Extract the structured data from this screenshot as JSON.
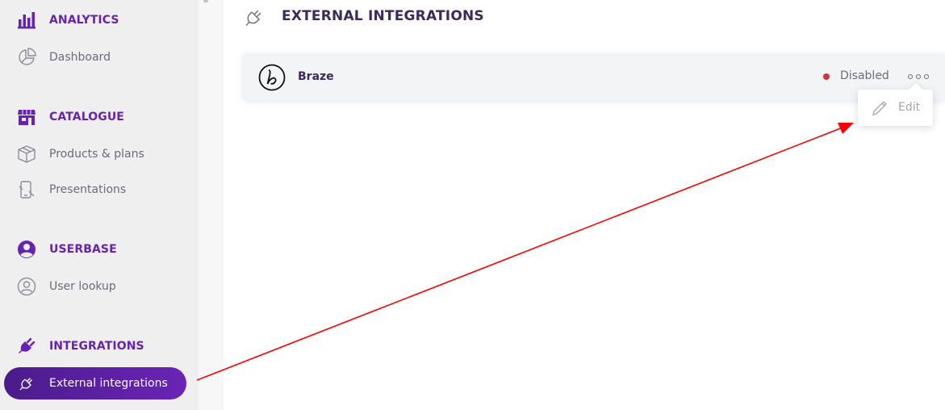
{
  "sidebar": {
    "sections": [
      {
        "label": "ANALYTICS",
        "icon": "bar-chart-icon"
      },
      {
        "label": "CATALOGUE",
        "icon": "store-icon"
      },
      {
        "label": "USERBASE",
        "icon": "user-circle-icon"
      },
      {
        "label": "INTEGRATIONS",
        "icon": "plug-icon"
      }
    ],
    "items": [
      {
        "label": "Dashboard",
        "icon": "pie-chart-icon"
      },
      {
        "label": "Products & plans",
        "icon": "box-icon"
      },
      {
        "label": "Presentations",
        "icon": "phone-icon"
      },
      {
        "label": "User lookup",
        "icon": "user-icon"
      },
      {
        "label": "External integrations",
        "icon": "plug-icon",
        "active": true
      }
    ]
  },
  "page": {
    "title": "EXTERNAL INTEGRATIONS",
    "icon": "plug-icon"
  },
  "integrations": [
    {
      "name": "Braze",
      "status": "Disabled",
      "status_color": "#d8313a",
      "logo": "braze-logo-icon"
    }
  ],
  "context_menu": {
    "items": [
      {
        "label": "Edit",
        "icon": "pencil-icon"
      }
    ]
  },
  "colors": {
    "accent": "#6623b0",
    "active_bg": "#5e21a7",
    "annotation_arrow": "#ff0000"
  }
}
